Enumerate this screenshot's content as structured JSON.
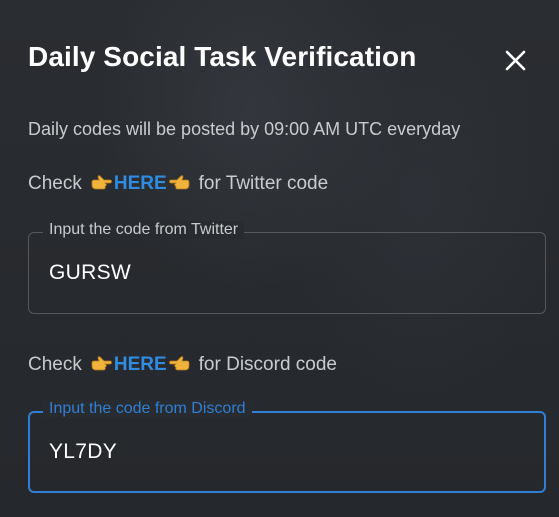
{
  "dialog": {
    "title": "Daily Social Task Verification",
    "close_icon": "close-icon",
    "notice": "Daily codes will be posted by 09:00 AM UTC everyday"
  },
  "twitter": {
    "check_prefix": "Check",
    "link_label": "HERE",
    "check_suffix": "for Twitter code",
    "field_label": "Input the code from Twitter",
    "field_value": "GURSW"
  },
  "discord": {
    "check_prefix": "Check",
    "link_label": "HERE",
    "check_suffix": "for Discord code",
    "field_label": "Input the code from Discord",
    "field_value": "YL7DY"
  },
  "icons": {
    "left_hand": "hand-pointing-right-icon",
    "right_hand": "hand-pointing-left-icon"
  },
  "colors": {
    "link": "#2f8ce0",
    "focus_border": "#2f80d4",
    "background": "#24272b"
  }
}
